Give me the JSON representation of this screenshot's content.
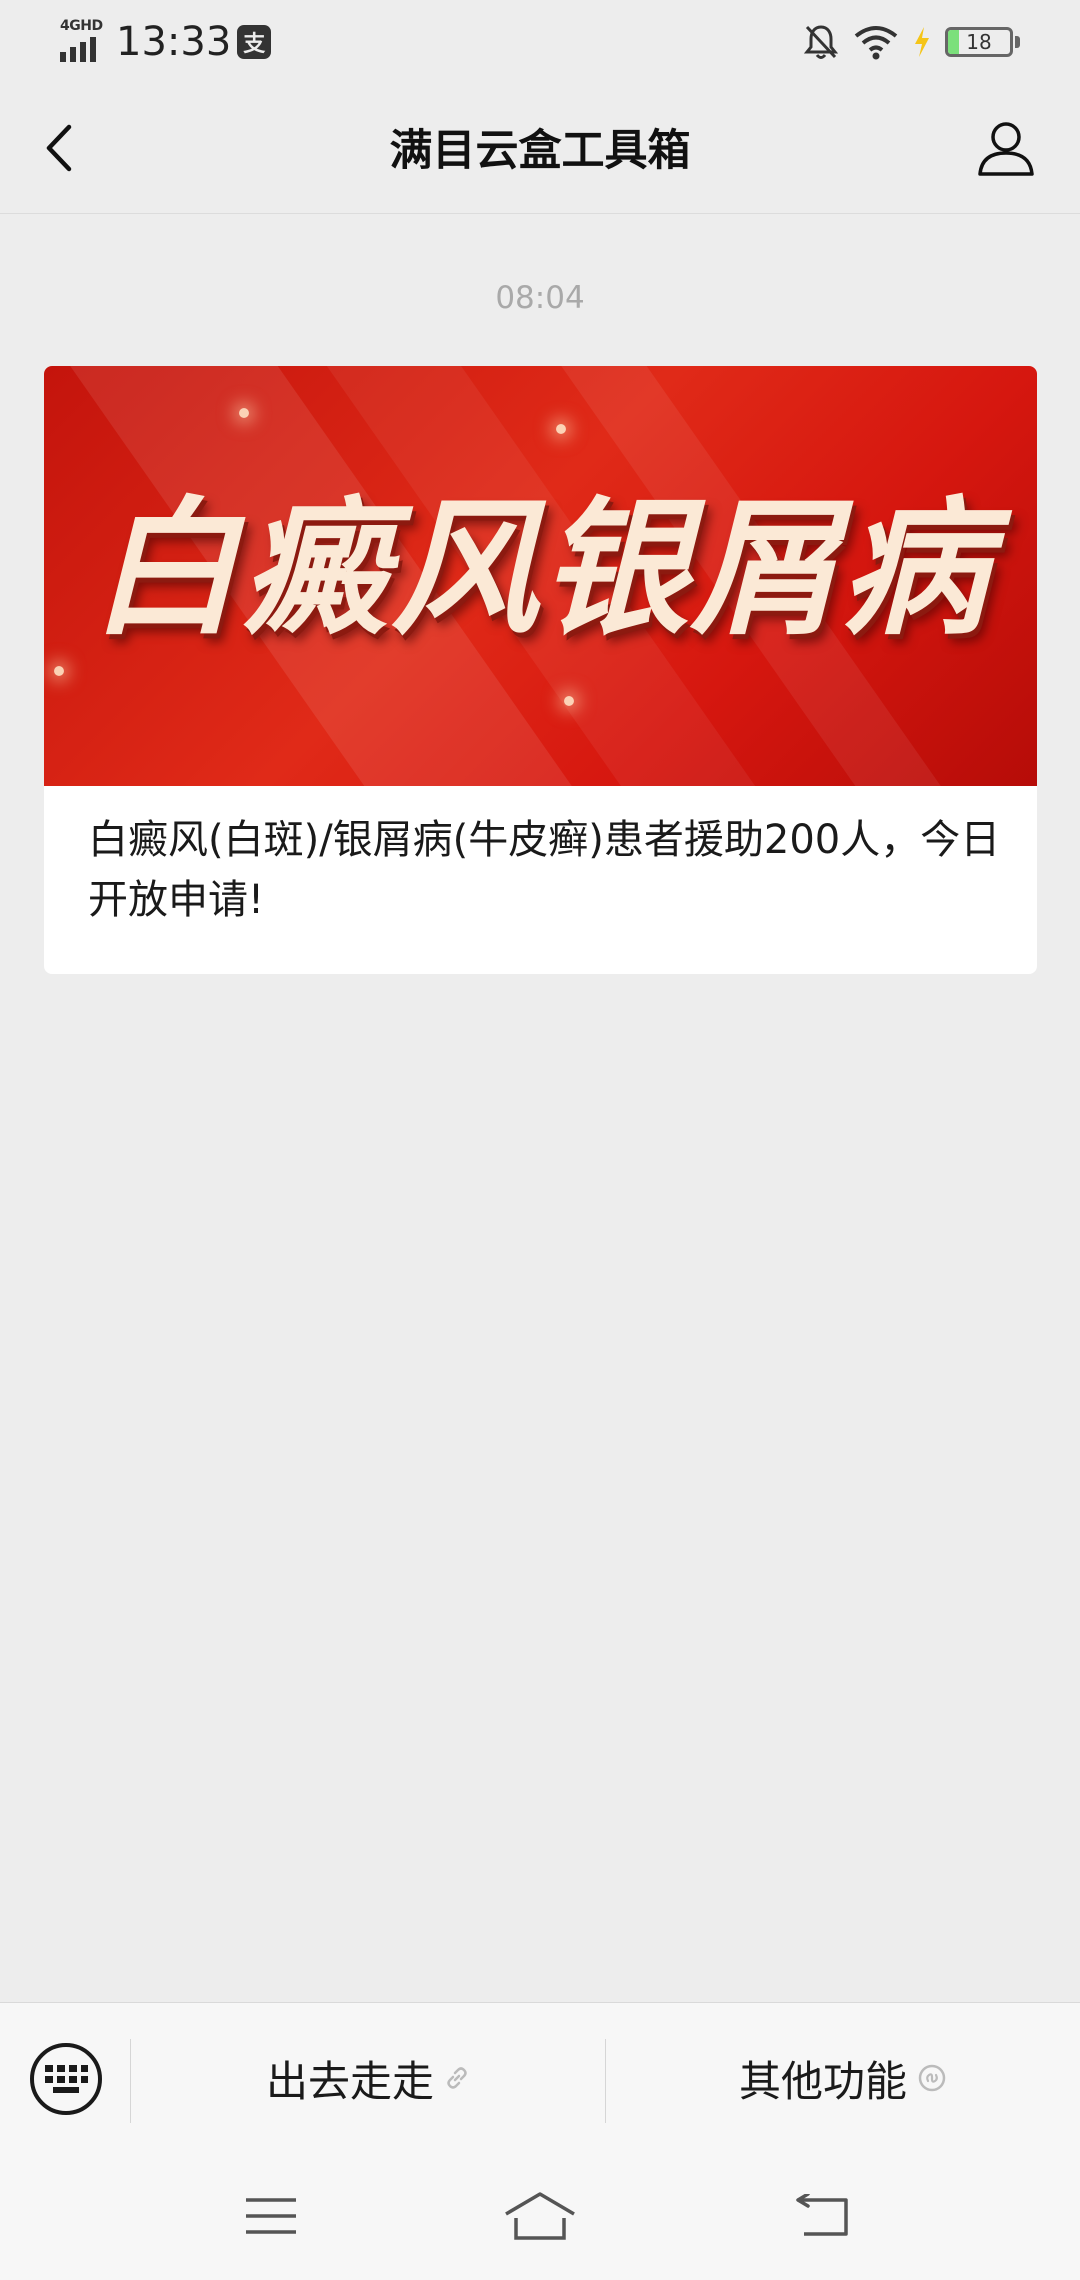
{
  "status_bar": {
    "network": "4GHD",
    "time": "13:33",
    "pay_badge": "支",
    "battery": "18",
    "battery_level": 0.18
  },
  "nav": {
    "title": "满目云盒工具箱"
  },
  "chat": {
    "timestamp": "08:04",
    "article": {
      "banner_text": "白癜风银屑病",
      "title": "白癜风(白斑)/银屑病(牛皮癣)患者援助200人，今日开放申请!"
    }
  },
  "bottom_menu": {
    "items": [
      {
        "label": "出去走走",
        "icon": "link-icon"
      },
      {
        "label": "其他功能",
        "icon": "mini-program-icon"
      }
    ]
  },
  "colors": {
    "background": "#ededed",
    "banner_red": "#d6170f",
    "timestamp_gray": "#a9a9a9"
  }
}
